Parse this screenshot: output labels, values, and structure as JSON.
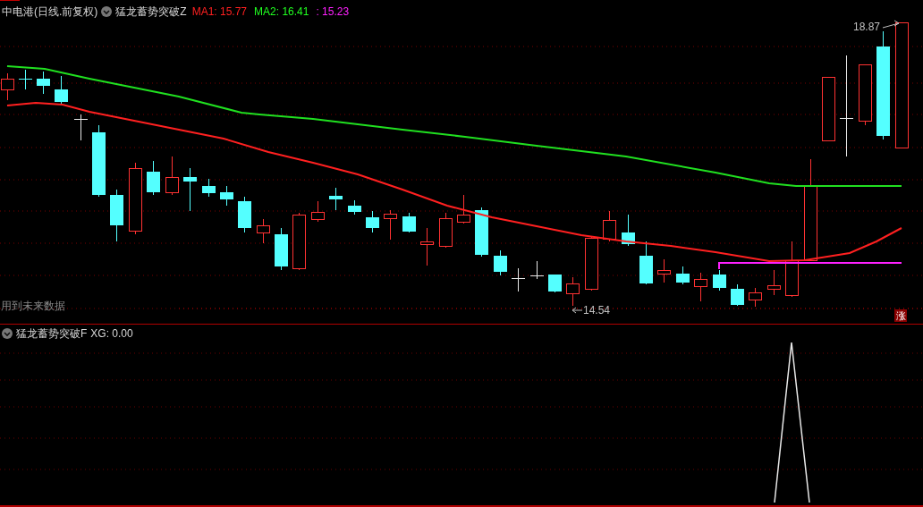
{
  "chart_header": {
    "title": "中电港(日线.前复权)",
    "indicator_name": "猛龙蓄势突破Z",
    "values": [
      {
        "text": "MA1: 15.77",
        "color": "#ff2020"
      },
      {
        "text": "MA2: 16.41",
        "color": "#20ff20"
      },
      {
        "text": ": 15.23",
        "color": "#ff20ff"
      }
    ]
  },
  "price_chart": {
    "high_label": "18.87",
    "low_label": "14.54",
    "warning": "用到未来数据",
    "badge": "涨"
  },
  "indicator_panel": {
    "title": "猛龙蓄势突破F",
    "readout": "XG: 0.00"
  }
}
